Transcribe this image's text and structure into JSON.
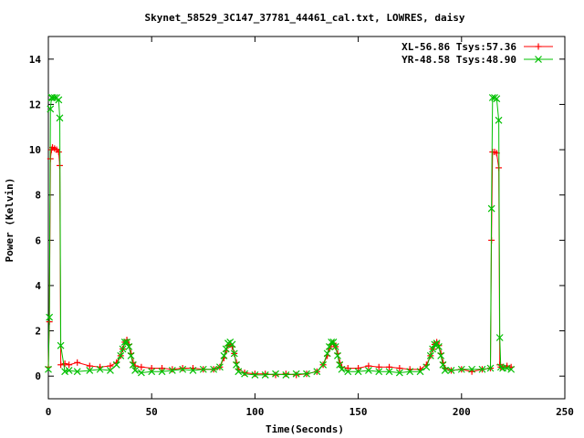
{
  "chart_data": {
    "type": "line",
    "title": "Skynet_58529_3C147_37781_44461_cal.txt, LOWRES, daisy",
    "xlabel": "Time(Seconds)",
    "ylabel": "Power (Kelvin)",
    "xlim": [
      0,
      250
    ],
    "ylim": [
      -1,
      15
    ],
    "xticks": [
      0,
      50,
      100,
      150,
      200,
      250
    ],
    "yticks": [
      0,
      2,
      4,
      6,
      8,
      10,
      12,
      14
    ],
    "grid": false,
    "legend_position": "top-right",
    "series": [
      {
        "name": "XL-56.86 Tsys:57.36",
        "color": "#ff0000",
        "marker": "plus",
        "x": [
          0,
          0.5,
          1,
          1.5,
          2,
          3,
          4,
          5,
          5.5,
          6,
          8,
          10,
          14,
          20,
          25,
          30,
          33,
          35,
          36,
          37,
          38,
          39,
          40,
          41,
          42,
          45,
          50,
          55,
          60,
          65,
          70,
          75,
          80,
          83,
          85,
          86,
          87,
          88,
          89,
          90,
          91,
          92,
          95,
          100,
          105,
          110,
          115,
          120,
          125,
          130,
          133,
          135,
          136,
          137,
          138,
          139,
          140,
          141,
          142,
          145,
          150,
          155,
          160,
          165,
          170,
          175,
          180,
          183,
          185,
          186,
          187,
          188,
          189,
          190,
          191,
          192,
          195,
          200,
          205,
          210,
          214,
          214.5,
          215,
          216,
          217,
          218,
          218.5,
          219,
          220,
          222,
          224
        ],
        "values": [
          0.4,
          2.4,
          9.6,
          10.0,
          10.1,
          10.05,
          10.0,
          9.9,
          9.3,
          0.5,
          0.55,
          0.5,
          0.6,
          0.45,
          0.4,
          0.45,
          0.6,
          0.9,
          1.2,
          1.5,
          1.6,
          1.4,
          1.0,
          0.6,
          0.45,
          0.4,
          0.35,
          0.35,
          0.3,
          0.35,
          0.35,
          0.3,
          0.3,
          0.4,
          0.8,
          1.1,
          1.35,
          1.4,
          1.3,
          1.0,
          0.6,
          0.3,
          0.15,
          0.1,
          0.1,
          0.05,
          0.1,
          0.05,
          0.1,
          0.2,
          0.5,
          0.9,
          1.2,
          1.4,
          1.45,
          1.3,
          1.0,
          0.6,
          0.4,
          0.35,
          0.35,
          0.45,
          0.4,
          0.4,
          0.35,
          0.3,
          0.3,
          0.5,
          0.9,
          1.2,
          1.4,
          1.5,
          1.35,
          1.0,
          0.6,
          0.35,
          0.25,
          0.3,
          0.2,
          0.3,
          0.35,
          6.0,
          9.9,
          9.9,
          9.85,
          9.2,
          0.5,
          0.4,
          0.4,
          0.45,
          0.4
        ]
      },
      {
        "name": "YR-48.58 Tsys:48.90",
        "color": "#00c000",
        "marker": "cross",
        "x": [
          0,
          0.5,
          1,
          1.5,
          2,
          3,
          4,
          5,
          5.5,
          6,
          8,
          10,
          14,
          20,
          25,
          30,
          33,
          35,
          36,
          37,
          38,
          39,
          40,
          41,
          42,
          45,
          50,
          55,
          60,
          65,
          70,
          75,
          80,
          83,
          85,
          86,
          87,
          88,
          89,
          90,
          91,
          92,
          95,
          100,
          105,
          110,
          115,
          120,
          125,
          130,
          133,
          135,
          136,
          137,
          138,
          139,
          140,
          141,
          142,
          145,
          150,
          155,
          160,
          165,
          170,
          175,
          180,
          183,
          185,
          186,
          187,
          188,
          189,
          190,
          191,
          192,
          195,
          200,
          205,
          210,
          214,
          214.5,
          215,
          216,
          217,
          218,
          218.5,
          219,
          220,
          222,
          224
        ],
        "values": [
          0.3,
          2.6,
          11.8,
          12.3,
          12.3,
          12.3,
          12.3,
          12.2,
          11.4,
          1.35,
          0.2,
          0.25,
          0.2,
          0.25,
          0.3,
          0.25,
          0.5,
          0.9,
          1.2,
          1.5,
          1.5,
          1.3,
          0.9,
          0.5,
          0.25,
          0.15,
          0.2,
          0.2,
          0.25,
          0.3,
          0.25,
          0.3,
          0.3,
          0.4,
          0.9,
          1.2,
          1.45,
          1.5,
          1.4,
          1.0,
          0.5,
          0.2,
          0.1,
          0.05,
          0.05,
          0.1,
          0.05,
          0.1,
          0.1,
          0.2,
          0.5,
          1.0,
          1.3,
          1.5,
          1.5,
          1.3,
          0.9,
          0.5,
          0.3,
          0.2,
          0.2,
          0.25,
          0.2,
          0.2,
          0.15,
          0.2,
          0.2,
          0.4,
          0.9,
          1.2,
          1.4,
          1.45,
          1.3,
          0.9,
          0.5,
          0.25,
          0.25,
          0.3,
          0.3,
          0.3,
          0.35,
          7.4,
          12.3,
          12.3,
          12.25,
          11.3,
          1.7,
          0.4,
          0.35,
          0.35,
          0.3
        ]
      }
    ]
  }
}
